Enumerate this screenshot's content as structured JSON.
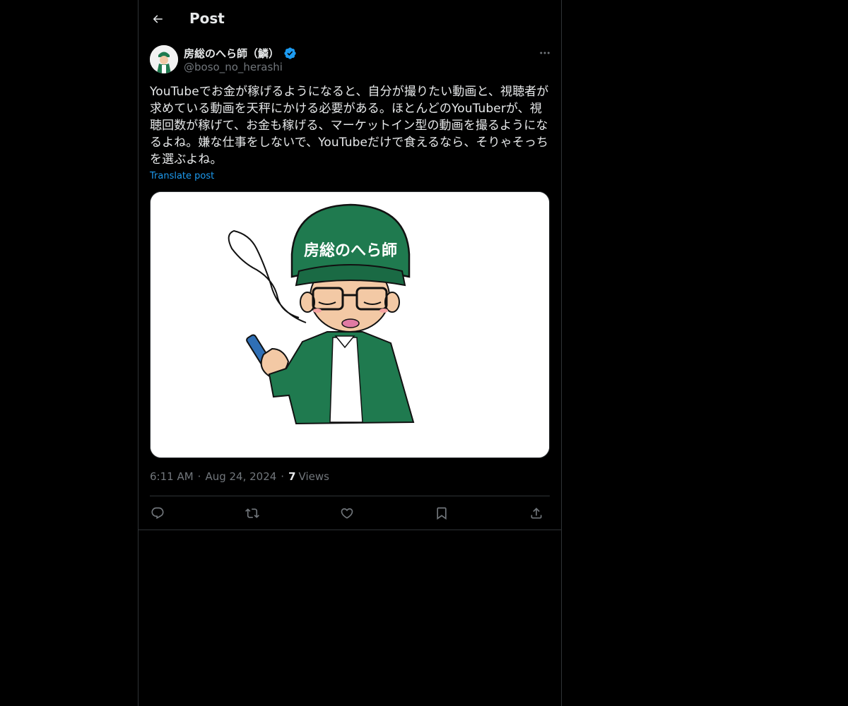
{
  "header": {
    "title": "Post"
  },
  "author": {
    "display_name": "房総のへら師（鱗）",
    "handle": "@boso_no_herashi",
    "verified": true
  },
  "post": {
    "text": "YouTubeでお金が稼げるようになると、自分が撮りたい動画と、視聴者が求めている動画を天秤にかける必要がある。ほとんどのYouTuberが、視聴回数が稼げて、お金も稼げる、マーケットイン型の動画を撮るようになるよね。嫌な仕事をしないで、YouTubeだけで食えるなら、そりゃそっちを選ぶよね。",
    "translate_label": "Translate post",
    "image_cap_text": "房総のへら師"
  },
  "meta": {
    "time": "6:11 AM",
    "date": "Aug 24, 2024",
    "separator": "·",
    "views_count": "7",
    "views_label": "Views"
  },
  "actions": [
    {
      "name": "reply",
      "icon": "reply-icon"
    },
    {
      "name": "repost",
      "icon": "repost-icon"
    },
    {
      "name": "like",
      "icon": "heart-icon"
    },
    {
      "name": "bookmark",
      "icon": "bookmark-icon"
    },
    {
      "name": "share",
      "icon": "share-icon"
    }
  ],
  "colors": {
    "background": "#000000",
    "text": "#e7e9ea",
    "muted": "#71767b",
    "accent": "#1d9bf0",
    "border": "#2f3336",
    "cap_green": "#1f7a4f"
  }
}
